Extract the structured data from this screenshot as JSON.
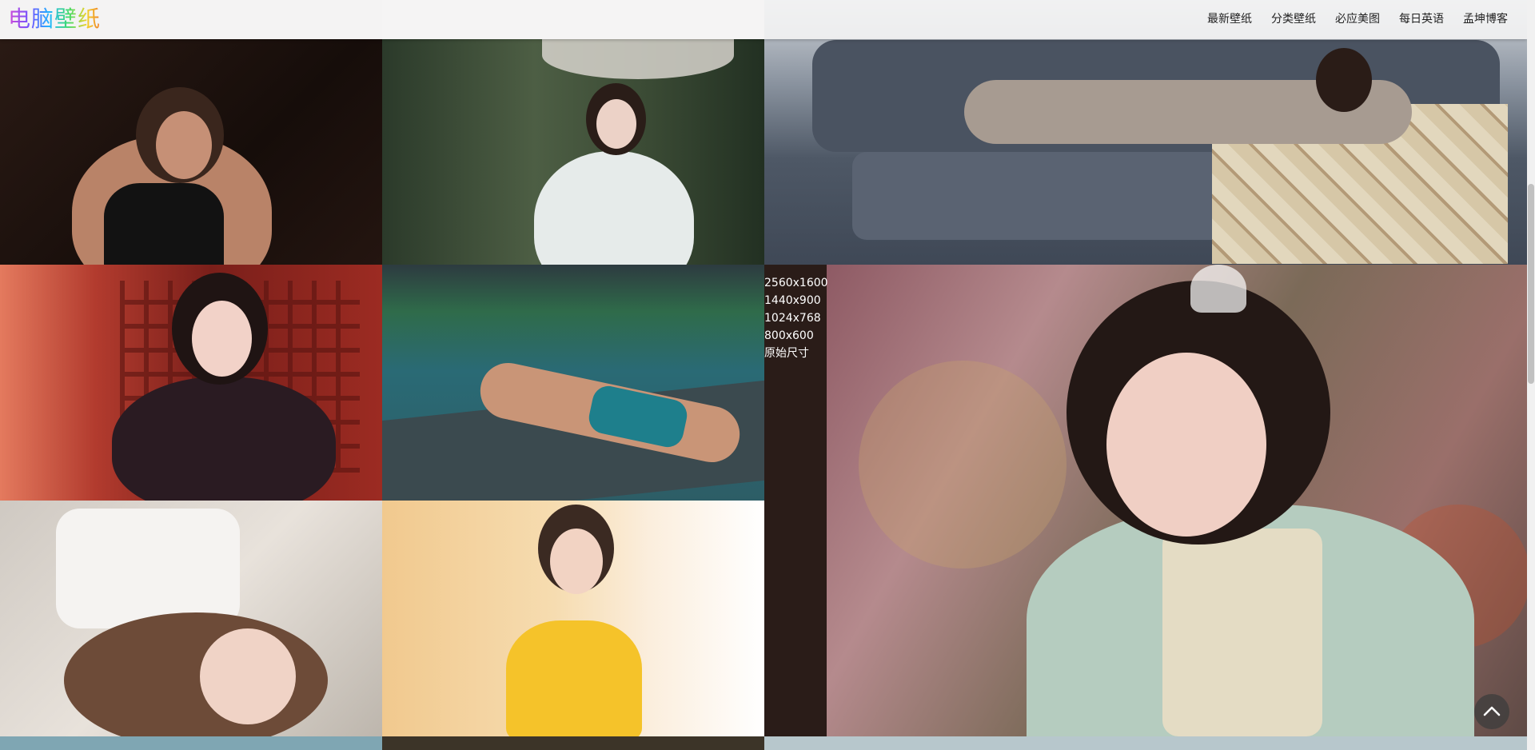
{
  "site": {
    "logo_text": "电脑壁纸"
  },
  "nav": {
    "items": [
      {
        "label": "最新壁纸"
      },
      {
        "label": "分类壁纸"
      },
      {
        "label": "必应美图"
      },
      {
        "label": "每日英语"
      },
      {
        "label": "孟坤博客"
      }
    ]
  },
  "size_options": {
    "items": [
      {
        "label": "2560x1600"
      },
      {
        "label": "1440x900"
      },
      {
        "label": "1024x768"
      },
      {
        "label": "800x600"
      },
      {
        "label": "原始尺寸"
      }
    ]
  },
  "gallery": {
    "tiles": [
      {
        "name": "wallpaper-thumb-1",
        "bg": "#1e1411",
        "accent": "#c9987e"
      },
      {
        "name": "wallpaper-thumb-2",
        "bg": "#3c4a35",
        "accent": "#e9ecea"
      },
      {
        "name": "wallpaper-thumb-3",
        "bg": "#4b5463",
        "accent": "#a9a199"
      },
      {
        "name": "wallpaper-thumb-4",
        "bg": "#8a2a22",
        "accent": "#f2d0c5"
      },
      {
        "name": "wallpaper-thumb-5",
        "bg": "#2f6f78",
        "accent": "#d6a283"
      },
      {
        "name": "wallpaper-thumb-6",
        "bg": "#d8d3cc",
        "accent": "#f1d9cd"
      },
      {
        "name": "wallpaper-thumb-7",
        "bg": "#f2d6a4",
        "accent": "#f6c12c"
      },
      {
        "name": "wallpaper-featured",
        "bg": "#8e6f6a",
        "accent": "#b8cdbf"
      }
    ]
  },
  "theme": {
    "nav_text_color": "#222222",
    "size_text_color": "#ffffff"
  }
}
